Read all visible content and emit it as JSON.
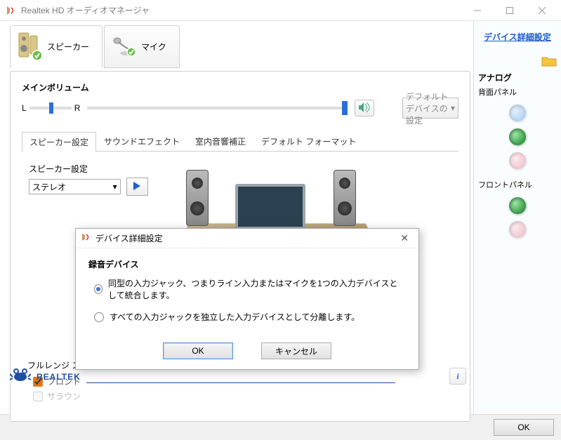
{
  "window": {
    "title": "Realtek HD オーディオマネージャ"
  },
  "device_tabs": {
    "speaker": "スピーカー",
    "mic": "マイク"
  },
  "volume": {
    "section_label": "メインボリューム",
    "L": "L",
    "R": "R",
    "default_device_btn": "デフォルトデバイスの設定"
  },
  "subtabs": {
    "t0": "スピーカー設定",
    "t1": "サウンドエフェクト",
    "t2": "室内音響補正",
    "t3": "デフォルト フォーマット"
  },
  "config": {
    "label": "スピーカー設定",
    "selected": "ステレオ"
  },
  "fullrange": {
    "title": "フルレンジ ス",
    "front": "フロント",
    "surround": "サラウン"
  },
  "right": {
    "advanced_link": "デバイス詳細設定",
    "analog": "アナログ",
    "rear_panel": "背面パネル",
    "front_panel": "フロントパネル"
  },
  "footer": {
    "brand": "REALTEK"
  },
  "bottom": {
    "ok": "OK"
  },
  "modal": {
    "title": "デバイス詳細設定",
    "section": "録音デバイス",
    "opt1": "同型の入力ジャック、つまりライン入力またはマイクを1つの入力デバイスとして統合します。",
    "opt2": "すべての入力ジャックを独立した入力デバイスとして分離します。",
    "ok": "OK",
    "cancel": "キャンセル"
  },
  "info_btn": "i"
}
